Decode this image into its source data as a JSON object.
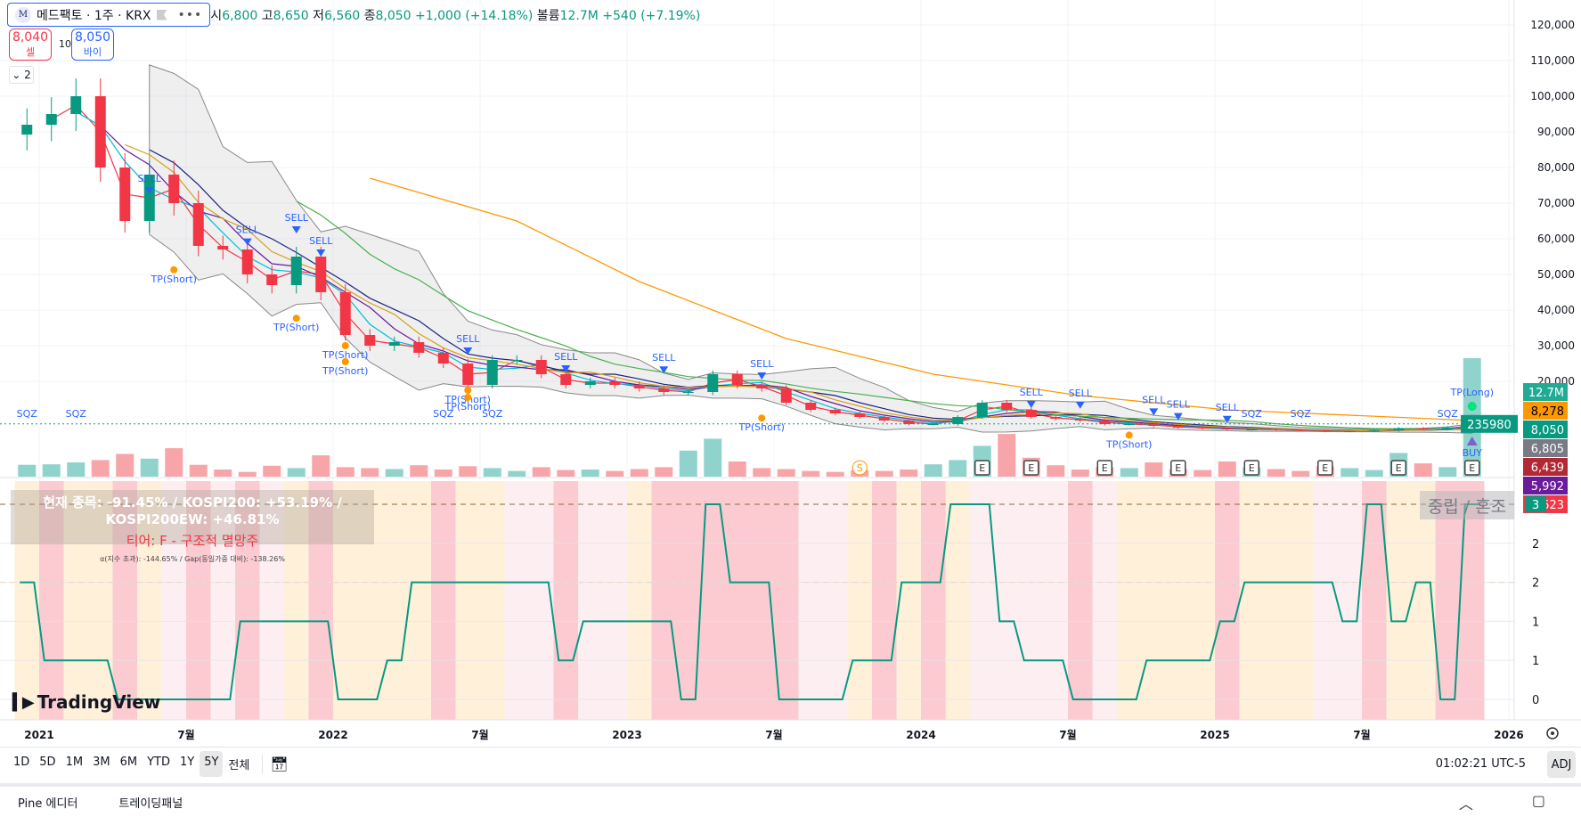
{
  "header": {
    "symbol_logo": "M",
    "symbol": "메드팩토 · 1주 · KRX",
    "more": "•••",
    "open_label": "시",
    "open": "6,800",
    "high_label": "고",
    "high": "8,650",
    "low_label": "저",
    "low": "6,560",
    "close_label": "종",
    "close": "8,050",
    "change": "+1,000 (+14.18%)",
    "volume_label": "볼륨",
    "volume": "12.7M",
    "volume_change": "+540 (+7.19%)"
  },
  "trade": {
    "sell_price": "8,040",
    "sell_label": "셀",
    "quantity": "10",
    "buy_price": "8,050",
    "buy_label": "바이"
  },
  "collapse_label": "2",
  "colors": {
    "up": "#089981",
    "down": "#f23645",
    "vol_up": "#8fd3cc",
    "vol_down": "#f7a5a8",
    "accent": "#2962ff",
    "regime_line": "#089981"
  },
  "price_axis": {
    "ticks": [
      "120,000",
      "110,000",
      "100,000",
      "90,000",
      "80,000",
      "70,000",
      "60,000",
      "50,000",
      "40,000",
      "30,000",
      "20,000"
    ],
    "tick_values": [
      120000,
      110000,
      100000,
      90000,
      80000,
      70000,
      60000,
      50000,
      40000,
      30000,
      20000
    ],
    "labels": [
      {
        "text": "12.7M",
        "color": "#22ab94"
      },
      {
        "text": "8,278",
        "color": "#ff9800",
        "dark": true
      },
      {
        "text": "8,050",
        "color": "#089981"
      },
      {
        "text": "6,805",
        "color": "#787b86"
      },
      {
        "text": "6,439",
        "color": "#b22833"
      },
      {
        "text": "5,992",
        "color": "#6a1b9a"
      },
      {
        "text": "5,623",
        "color": "#f23645"
      }
    ],
    "countdown": "235980"
  },
  "time_axis": {
    "labels": [
      {
        "text": "2021",
        "date": "2021-01"
      },
      {
        "text": "7월",
        "date": "2021-07"
      },
      {
        "text": "2022",
        "date": "2022-01"
      },
      {
        "text": "7월",
        "date": "2022-07"
      },
      {
        "text": "2023",
        "date": "2023-01"
      },
      {
        "text": "7월",
        "date": "2023-07"
      },
      {
        "text": "2024",
        "date": "2024-01"
      },
      {
        "text": "7월",
        "date": "2024-07"
      },
      {
        "text": "2025",
        "date": "2025-01"
      },
      {
        "text": "7월",
        "date": "2025-07"
      },
      {
        "text": "2026",
        "date": "2026-01"
      }
    ]
  },
  "chart_data": {
    "type": "candlestick",
    "start": "2020-12",
    "interval": "month",
    "close": [
      92000,
      95000,
      100000,
      80000,
      65000,
      78000,
      70000,
      58000,
      57000,
      50000,
      47000,
      55000,
      45000,
      33000,
      30000,
      31000,
      28000,
      25000,
      19000,
      26000,
      26000,
      22000,
      19000,
      20000,
      19000,
      18000,
      17000,
      17000,
      22000,
      19000,
      18000,
      14000,
      12000,
      11000,
      10000,
      9000,
      8000,
      8000,
      10000,
      14000,
      12000,
      10000,
      9500,
      9000,
      8000,
      8000,
      7500,
      7000,
      6800,
      6500,
      6500,
      6300,
      6200,
      6000,
      6000,
      6200,
      6800,
      6500,
      7050,
      8050
    ],
    "volume_m": [
      2.5,
      2.6,
      3.0,
      3.5,
      4.8,
      3.8,
      6.0,
      2.5,
      1.5,
      1.0,
      2.3,
      1.8,
      4.5,
      2.0,
      1.8,
      1.6,
      2.4,
      1.5,
      2.2,
      1.8,
      1.2,
      2.0,
      1.4,
      1.5,
      1.2,
      1.6,
      2.0,
      5.5,
      8.0,
      3.2,
      1.8,
      1.6,
      1.2,
      1.0,
      1.4,
      1.2,
      1.5,
      2.6,
      3.5,
      6.5,
      9.0,
      4.0,
      2.4,
      1.5,
      2.0,
      1.8,
      3.0,
      1.6,
      1.4,
      3.2,
      2.0,
      1.6,
      1.2,
      2.2,
      1.8,
      1.4,
      5.0,
      2.8,
      2.0,
      25.0
    ],
    "ma_long": [
      [
        "2022-02",
        77000
      ],
      [
        "2022-08",
        65000
      ],
      [
        "2023-01",
        48000
      ],
      [
        "2023-07",
        32000
      ],
      [
        "2024-01",
        22000
      ],
      [
        "2024-07",
        16000
      ],
      [
        "2025-01",
        12000
      ],
      [
        "2025-11",
        9000
      ]
    ],
    "price_range": [
      0,
      127000
    ],
    "annotations": [
      {
        "text": "SELL",
        "date": "2021-05",
        "price": 76000,
        "kind": "sell"
      },
      {
        "text": "SELL",
        "date": "2021-09",
        "price": 61600,
        "kind": "sell"
      },
      {
        "text": "SELL",
        "date": "2021-11",
        "price": 65000,
        "kind": "sell"
      },
      {
        "text": "SELL",
        "date": "2021-12",
        "price": 58500,
        "kind": "sell"
      },
      {
        "text": "SELL",
        "date": "2022-06",
        "price": 31000,
        "kind": "sell"
      },
      {
        "text": "SELL",
        "date": "2022-10",
        "price": 26000,
        "kind": "sell"
      },
      {
        "text": "SELL",
        "date": "2023-02",
        "price": 25700,
        "kind": "sell"
      },
      {
        "text": "SELL",
        "date": "2023-06",
        "price": 24000,
        "kind": "sell"
      },
      {
        "text": "SELL",
        "date": "2024-05",
        "price": 16000,
        "kind": "sell"
      },
      {
        "text": "SELL",
        "date": "2024-07",
        "price": 15800,
        "kind": "sell"
      },
      {
        "text": "SELL",
        "date": "2024-10",
        "price": 13900,
        "kind": "sell"
      },
      {
        "text": "SELL",
        "date": "2024-11",
        "price": 12600,
        "kind": "sell"
      },
      {
        "text": "SELL",
        "date": "2025-01",
        "price": 11800,
        "kind": "sell"
      },
      {
        "text": "TP(Short)",
        "date": "2021-06",
        "price": 47800,
        "kind": "tp"
      },
      {
        "text": "TP(Short)",
        "date": "2021-11",
        "price": 34200,
        "kind": "tp"
      },
      {
        "text": "TP(Short)",
        "date": "2022-01",
        "price": 26500,
        "kind": "tp"
      },
      {
        "text": "TP(Short)",
        "date": "2022-01",
        "price": 22000,
        "kind": "tp"
      },
      {
        "text": "TP(Short)",
        "date": "2022-06",
        "price": 14000,
        "kind": "tp"
      },
      {
        "text": "TP(Short)",
        "date": "2022-06",
        "price": 12000,
        "kind": "tp"
      },
      {
        "text": "TP(Short)",
        "date": "2023-06",
        "price": 6200,
        "kind": "tp"
      },
      {
        "text": "TP(Short)",
        "date": "2024-09",
        "price": 1400,
        "kind": "tp"
      },
      {
        "text": "TP(Long)",
        "date": "2025-11",
        "price": 16000,
        "kind": "tplong"
      },
      {
        "text": "BUY",
        "date": "2025-11",
        "price": 0,
        "kind": "buy"
      },
      {
        "text": "SQZ",
        "date": "2020-12",
        "price": 10000,
        "kind": "sqz"
      },
      {
        "text": "SQZ",
        "date": "2021-02",
        "price": 10000,
        "kind": "sqz"
      },
      {
        "text": "SQZ",
        "date": "2022-05",
        "price": 10000,
        "kind": "sqz"
      },
      {
        "text": "SQZ",
        "date": "2022-07",
        "price": 10000,
        "kind": "sqz"
      },
      {
        "text": "SQZ",
        "date": "2025-02",
        "price": 10000,
        "kind": "sqz"
      },
      {
        "text": "SQZ",
        "date": "2025-04",
        "price": 10000,
        "kind": "sqz"
      },
      {
        "text": "SQZ",
        "date": "2025-10",
        "price": 10000,
        "kind": "sqz"
      }
    ],
    "events": [
      {
        "text": "S",
        "date": "2023-10",
        "kind": "split"
      },
      {
        "text": "E",
        "date": "2024-03"
      },
      {
        "text": "E",
        "date": "2024-05"
      },
      {
        "text": "E",
        "date": "2024-08"
      },
      {
        "text": "E",
        "date": "2024-11"
      },
      {
        "text": "E",
        "date": "2025-02"
      },
      {
        "text": "E",
        "date": "2025-05"
      },
      {
        "text": "E",
        "date": "2025-08"
      },
      {
        "text": "E",
        "date": "2025-11"
      }
    ],
    "indicator": {
      "ticks": [
        3,
        2.4,
        1.8,
        1.2,
        0.6,
        0
      ],
      "tick_labels": [
        "3",
        "2",
        "2",
        "1",
        "1",
        "0"
      ],
      "current_label": "3",
      "values": [
        1.8,
        0.6,
        0.6,
        0.6,
        0,
        0,
        0,
        0,
        0,
        1.2,
        1.2,
        1.2,
        1.2,
        0,
        0,
        0.6,
        1.8,
        1.8,
        1.8,
        1.8,
        1.8,
        1.8,
        0.6,
        1.2,
        1.2,
        1.2,
        1.2,
        0,
        3,
        1.8,
        1.8,
        0,
        0,
        0,
        0.6,
        0.6,
        1.8,
        1.8,
        3,
        3,
        1.2,
        0.6,
        0.6,
        0,
        0,
        0,
        0.6,
        0.6,
        0.6,
        1.2,
        1.8,
        1.8,
        1.8,
        1.8,
        1.2,
        3,
        1.2,
        1.8,
        0,
        3
      ],
      "background": [
        "n",
        "b",
        "n",
        "n",
        "b",
        "n",
        "w",
        "b",
        "w",
        "b",
        "w",
        "n",
        "b",
        "n",
        "n",
        "n",
        "n",
        "b",
        "n",
        "n",
        "w",
        "w",
        "b",
        "w",
        "w",
        "n",
        "b",
        "b",
        "b",
        "b",
        "b",
        "b",
        "w",
        "w",
        "n",
        "b",
        "n",
        "b",
        "n",
        "w",
        "w",
        "w",
        "w",
        "b",
        "w",
        "n",
        "n",
        "n",
        "n",
        "b",
        "n",
        "n",
        "n",
        "w",
        "w",
        "b",
        "n",
        "n",
        "b",
        "b"
      ],
      "background_colors": {
        "n": "#fff0d9",
        "b": "#fbcbd1",
        "w": "#fdeff1"
      }
    }
  },
  "info_box": {
    "line1": "현재 종목: -91.45% / KOSPI200: +53.19% / KOSPI200EW: +46.81%",
    "line2": "티어: F - 구조적 멸망주",
    "line3": "α(지수 초과): -144.65% / Gap(동일가중 대비): -138.26%"
  },
  "regime_label": "중립 / 혼조",
  "brand": "TradingView",
  "ranges": [
    "1D",
    "5D",
    "1M",
    "3M",
    "6M",
    "YTD",
    "1Y",
    "5Y",
    "전체"
  ],
  "active_range": "5Y",
  "clock": "01:02:21 UTC-5",
  "adj": "ADJ",
  "bottom": {
    "pine": "Pine 에디터",
    "trading": "트레이딩패널"
  }
}
